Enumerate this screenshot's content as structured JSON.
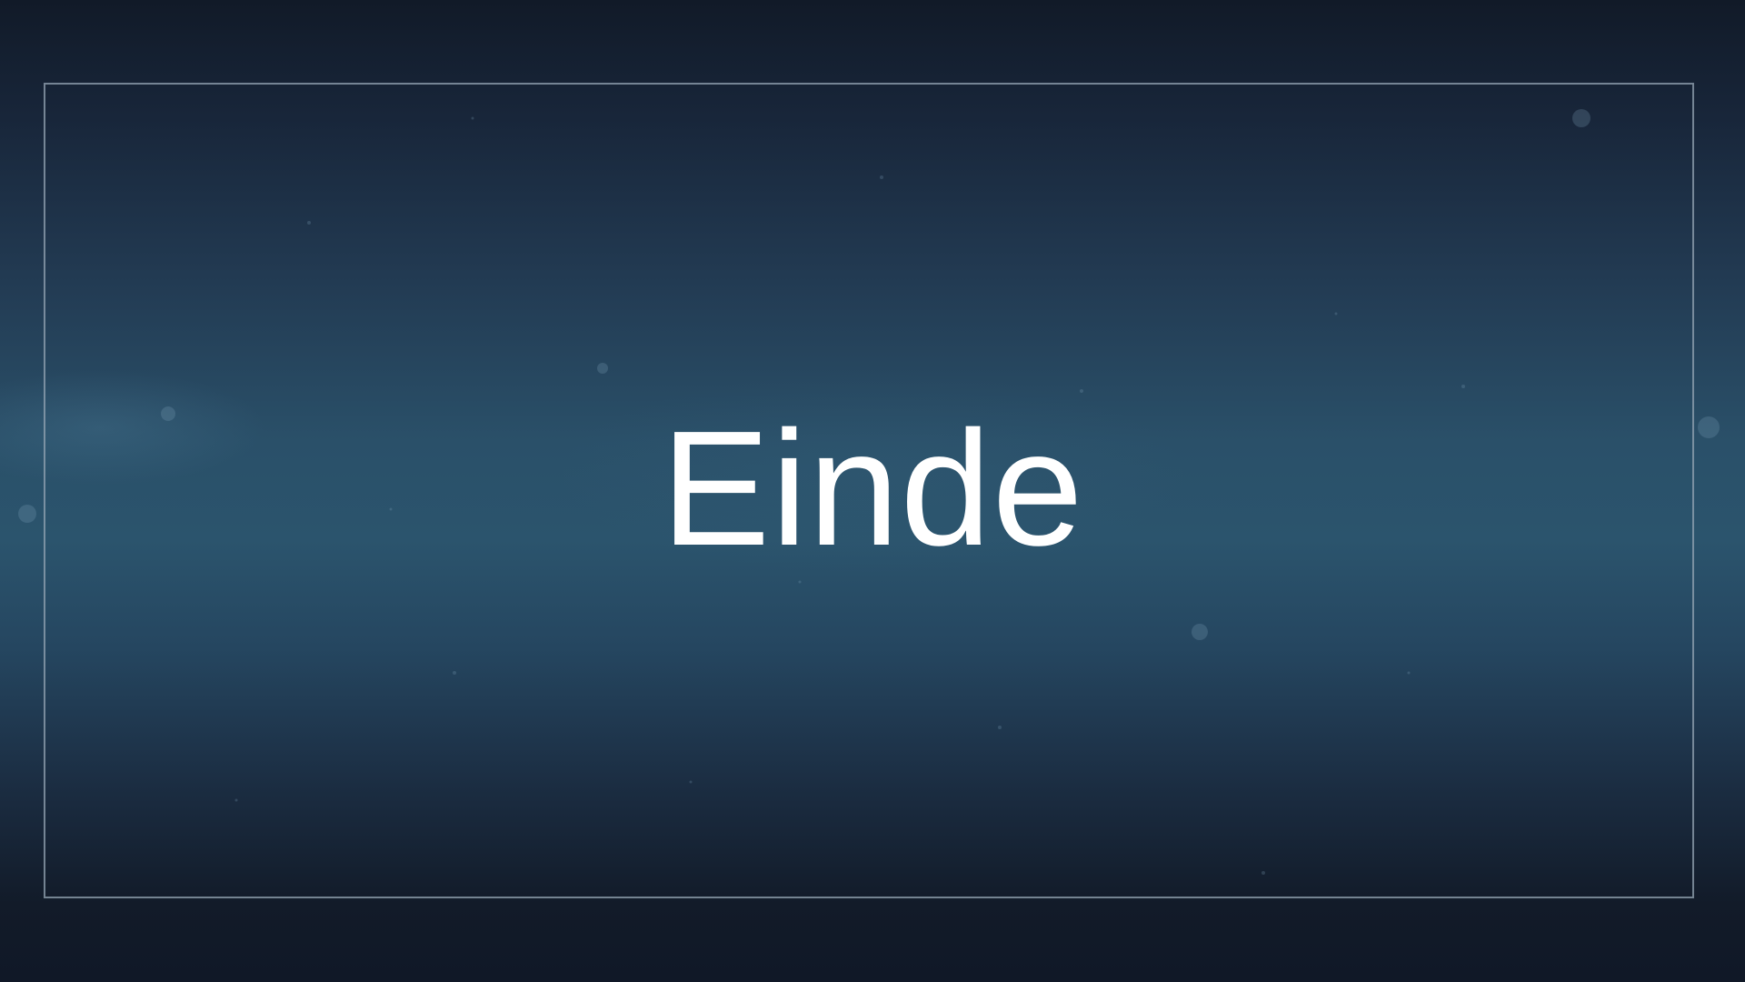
{
  "slide": {
    "title": "Einde"
  },
  "colors": {
    "background_dark": "#111a28",
    "background_mid": "#2b546d",
    "frame_border": "#96a5b4",
    "title_text": "#ffffff"
  }
}
